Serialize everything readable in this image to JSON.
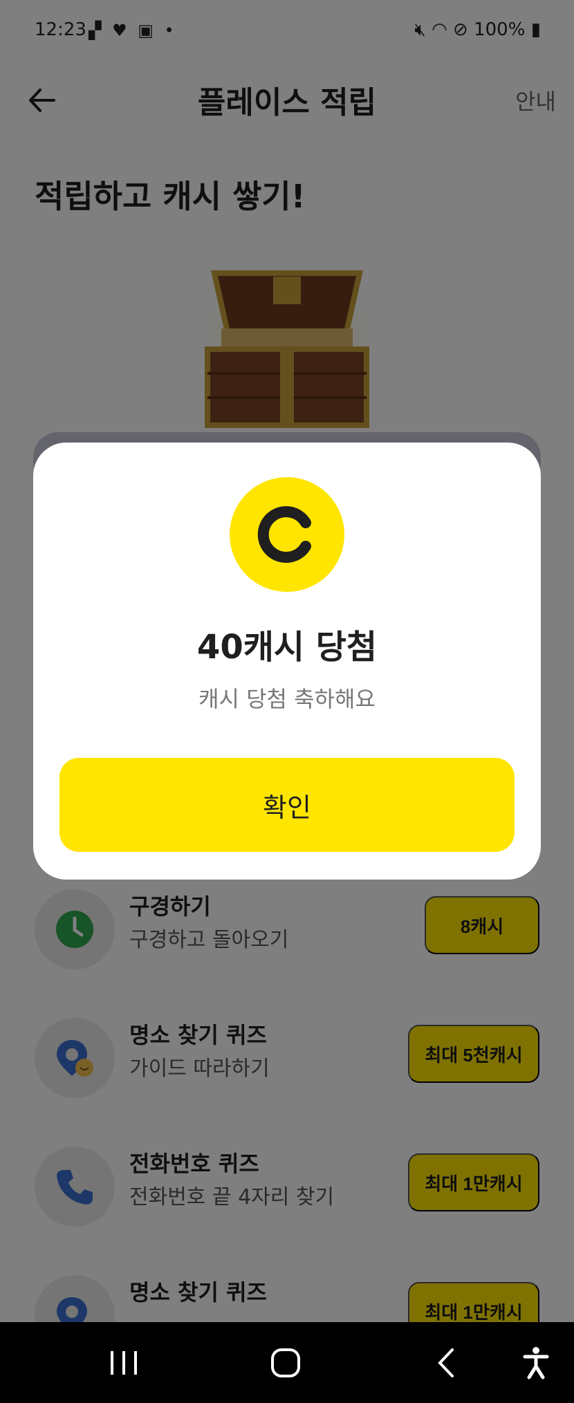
{
  "status_bar": {
    "time": "12:23",
    "left_icons": "▞ ♥ ▣ •",
    "battery": "100%"
  },
  "header": {
    "title": "플레이스 적립",
    "guide_label": "안내"
  },
  "headline": "적립하고 캐시 쌓기!",
  "items": [
    {
      "title": "구경하기",
      "subtitle": "구경하고 돌아오기",
      "reward": "8캐시",
      "icon": "clock-icon"
    },
    {
      "title": "명소 찾기 퀴즈",
      "subtitle": "가이드 따라하기",
      "reward": "최대 5천캐시",
      "icon": "map-pin-icon"
    },
    {
      "title": "전화번호 퀴즈",
      "subtitle": "전화번호 끝 4자리 찾기",
      "reward": "최대 1만캐시",
      "icon": "phone-icon"
    },
    {
      "title": "명소 찾기 퀴즈",
      "subtitle": "",
      "reward": "최대 1만캐시",
      "icon": "map-pin-icon"
    }
  ],
  "modal": {
    "title": "40캐시 당첨",
    "subtitle": "캐시 당첨 축하해요",
    "confirm_label": "확인",
    "icon": "cash-coin-icon"
  },
  "colors": {
    "accent": "#ffe500",
    "text": "#1f1f1f",
    "muted": "#777777"
  }
}
